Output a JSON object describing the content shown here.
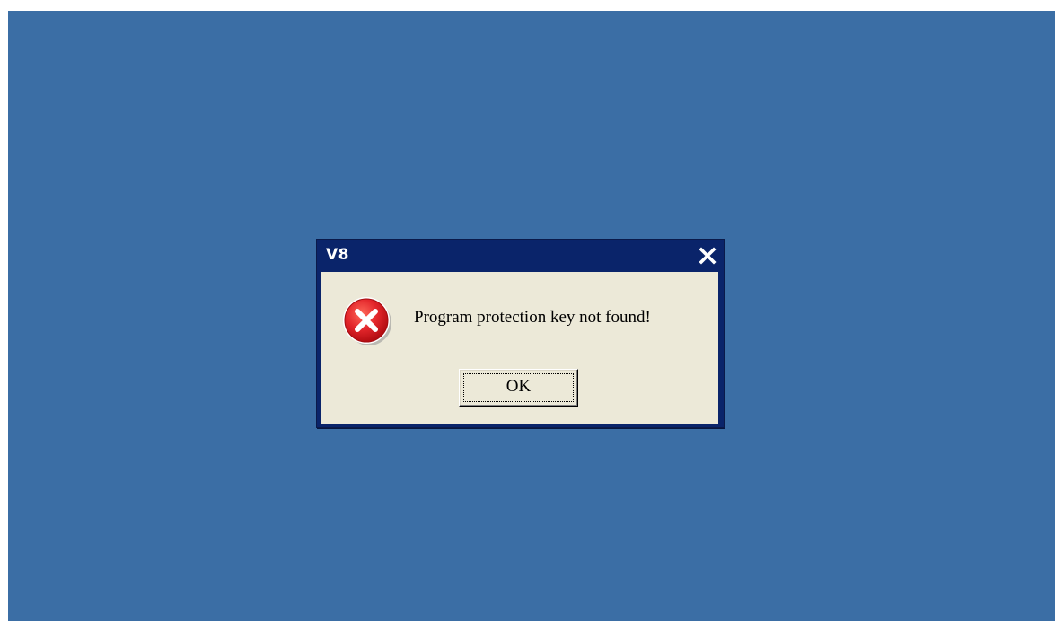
{
  "desktop": {
    "background_color": "#3b6ea5"
  },
  "dialog": {
    "title": "V8",
    "close_icon": "close-icon",
    "message": "Program protection key not found!",
    "icon": "error-icon",
    "ok_label": "OK",
    "title_bar_color": "#0a246a",
    "body_color": "#ece9d8",
    "icon_color": "#d9141e"
  }
}
